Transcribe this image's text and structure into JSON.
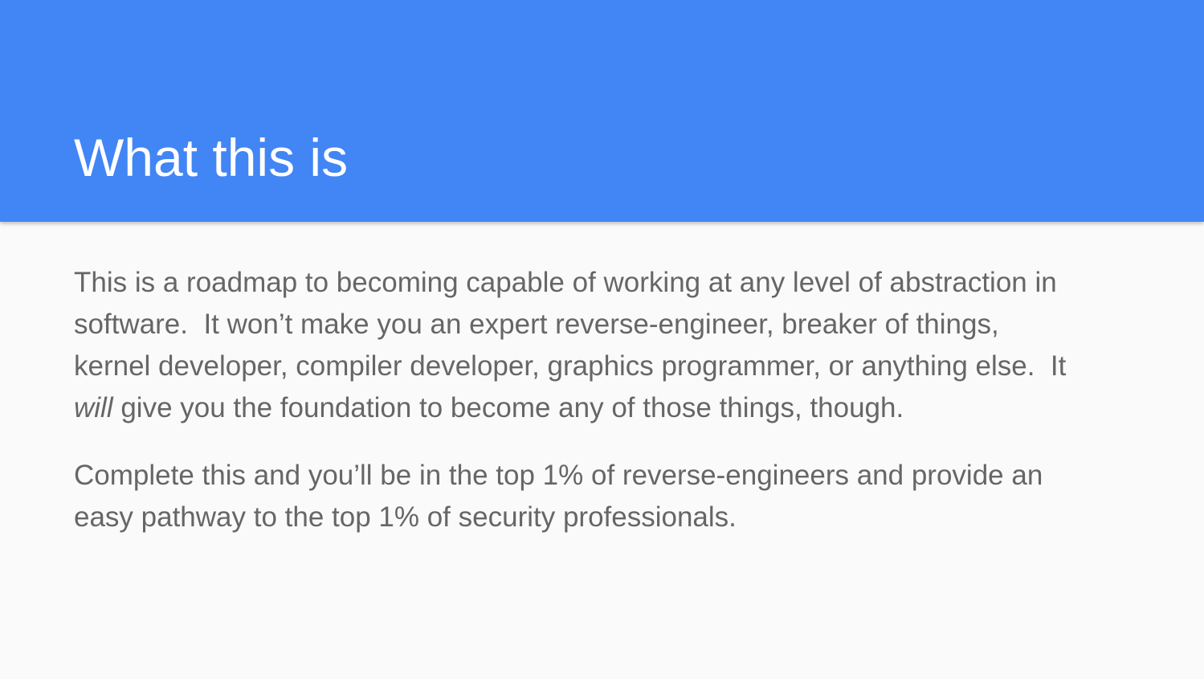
{
  "slide": {
    "title": "What this is",
    "paragraph1": {
      "line1": "This is a roadmap to becoming capable of working at any level of abstraction in",
      "line2": "software.  It won’t make you an expert reverse-engineer, breaker of things,",
      "line3": "kernel developer, compiler developer, graphics programmer, or anything else.  It",
      "line4_emphasis": "will",
      "line4_rest": " give you the foundation to become any of those things, though."
    },
    "paragraph2": {
      "line1": "Complete this and you’ll be in the top 1% of reverse-engineers and provide an",
      "line2": "easy pathway to the top 1% of security professionals."
    }
  },
  "colors": {
    "header_background": "#4285f4",
    "title_text": "#ffffff",
    "body_text": "#666666",
    "slide_background": "#fafafa"
  }
}
